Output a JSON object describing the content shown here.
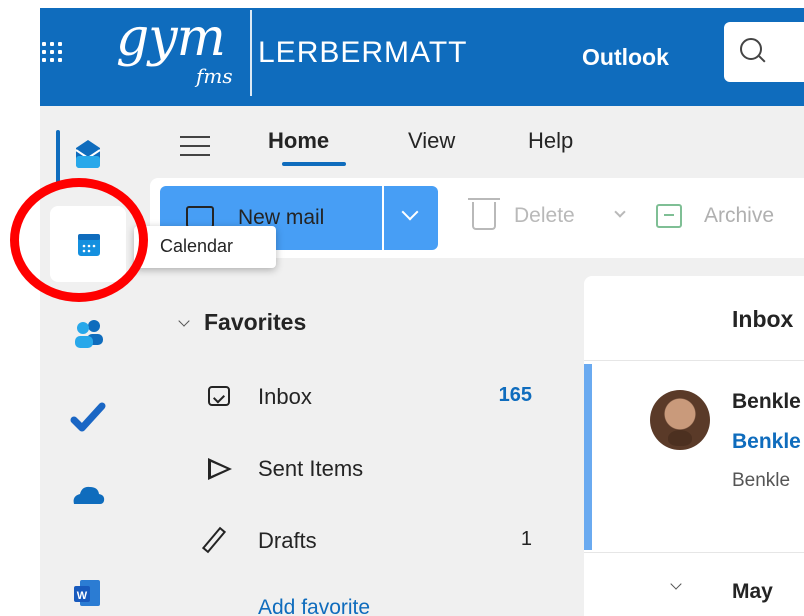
{
  "header": {
    "logo_script": "gym",
    "logo_sub": "fms",
    "logo_text": "LERBERMATT",
    "app_name": "Outlook",
    "search_icon": "search-icon"
  },
  "rail": {
    "items": [
      {
        "name": "mail",
        "icon": "mail-icon"
      },
      {
        "name": "calendar",
        "icon": "calendar-icon"
      },
      {
        "name": "people",
        "icon": "people-icon"
      },
      {
        "name": "to-do",
        "icon": "checkmark-icon"
      },
      {
        "name": "onedrive",
        "icon": "cloud-icon"
      },
      {
        "name": "word",
        "icon": "word-icon"
      }
    ],
    "tooltip": "Calendar"
  },
  "tabs": [
    "Home",
    "View",
    "Help"
  ],
  "ribbon": {
    "new_mail": "New mail",
    "delete": "Delete",
    "archive": "Archive"
  },
  "favorites": {
    "label": "Favorites",
    "items": [
      {
        "label": "Inbox",
        "count": "165"
      },
      {
        "label": "Sent Items",
        "count": ""
      },
      {
        "label": "Drafts",
        "count": "1"
      }
    ],
    "add_favorite": "Add favorite"
  },
  "message_list": {
    "title": "Inbox",
    "message": {
      "sender": "Benkle",
      "subject": "Benkle",
      "preview": "Benkle"
    },
    "group": "May"
  },
  "colors": {
    "brand": "#0f6cbd",
    "primary_button": "#479ef5",
    "annotation": "#ff0000"
  }
}
